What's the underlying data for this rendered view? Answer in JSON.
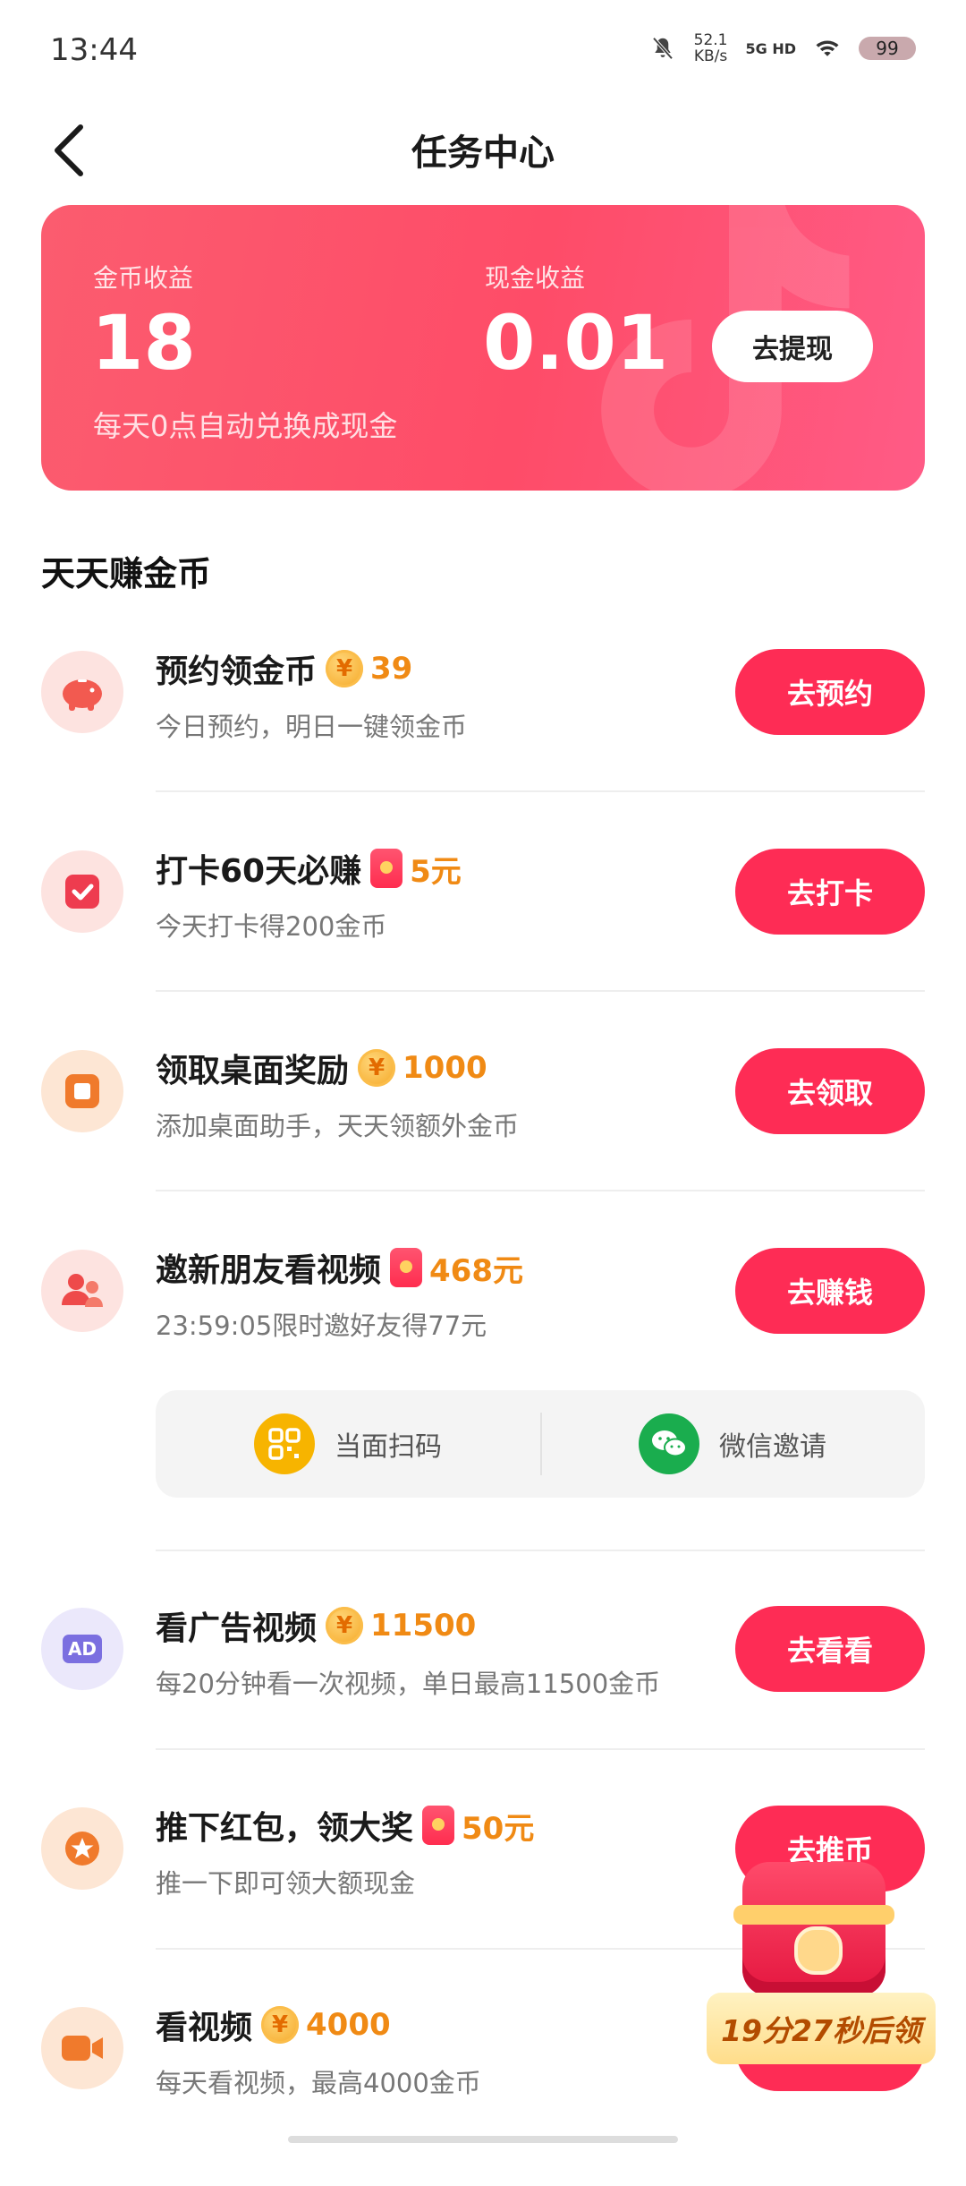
{
  "status_bar": {
    "time": "13:44",
    "speed_value": "52.1",
    "speed_unit": "KB/s",
    "network": "5G HD",
    "battery": "99"
  },
  "header": {
    "title": "任务中心"
  },
  "earnings": {
    "coin_label": "金币收益",
    "coin_value": "18",
    "cash_label": "现金收益",
    "cash_value": "0.01",
    "note": "每天0点自动兑换成现金",
    "withdraw_label": "去提现"
  },
  "section_title": "天天赚金币",
  "tasks": [
    {
      "title": "预约领金币",
      "reward": "39",
      "reward_type": "coin",
      "desc": "今日预约，明日一键领金币",
      "button": "去预约",
      "icon": "piggy-bank-icon"
    },
    {
      "title": "打卡60天必赚",
      "reward": "5元",
      "reward_type": "red-packet",
      "desc": "今天打卡得200金币",
      "button": "去打卡",
      "icon": "checkbox-icon"
    },
    {
      "title": "领取桌面奖励",
      "reward": "1000",
      "reward_type": "coin",
      "desc": "添加桌面助手，天天领额外金币",
      "button": "去领取",
      "icon": "desktop-widget-icon"
    },
    {
      "title": "邀新朋友看视频",
      "reward": "468元",
      "reward_type": "red-packet",
      "desc": "23:59:05限时邀好友得77元",
      "button": "去赚钱",
      "icon": "invite-friends-icon"
    },
    {
      "title": "看广告视频",
      "reward": "11500",
      "reward_type": "coin",
      "desc": "每20分钟看一次视频，单日最高11500金币",
      "button": "去看看",
      "icon": "ad-icon",
      "icon_text": "AD"
    },
    {
      "title": "推下红包，领大奖",
      "reward": "50元",
      "reward_type": "red-packet",
      "desc": "推一下即可领大额现金",
      "button": "去推币",
      "icon": "star-badge-icon"
    },
    {
      "title": "看视频",
      "reward": "4000",
      "reward_type": "coin",
      "desc": "每天看视频，最高4000金币",
      "button": "",
      "icon": "video-camera-icon"
    }
  ],
  "invite": {
    "scan_label": "当面扫码",
    "wechat_label": "微信邀请"
  },
  "treasure": {
    "timer": "19分27秒后领"
  },
  "colors": {
    "accent": "#fe2c55",
    "reward": "#f08a14",
    "card_gradient_start": "#fb5c6f",
    "card_gradient_end": "#ff5b86"
  }
}
